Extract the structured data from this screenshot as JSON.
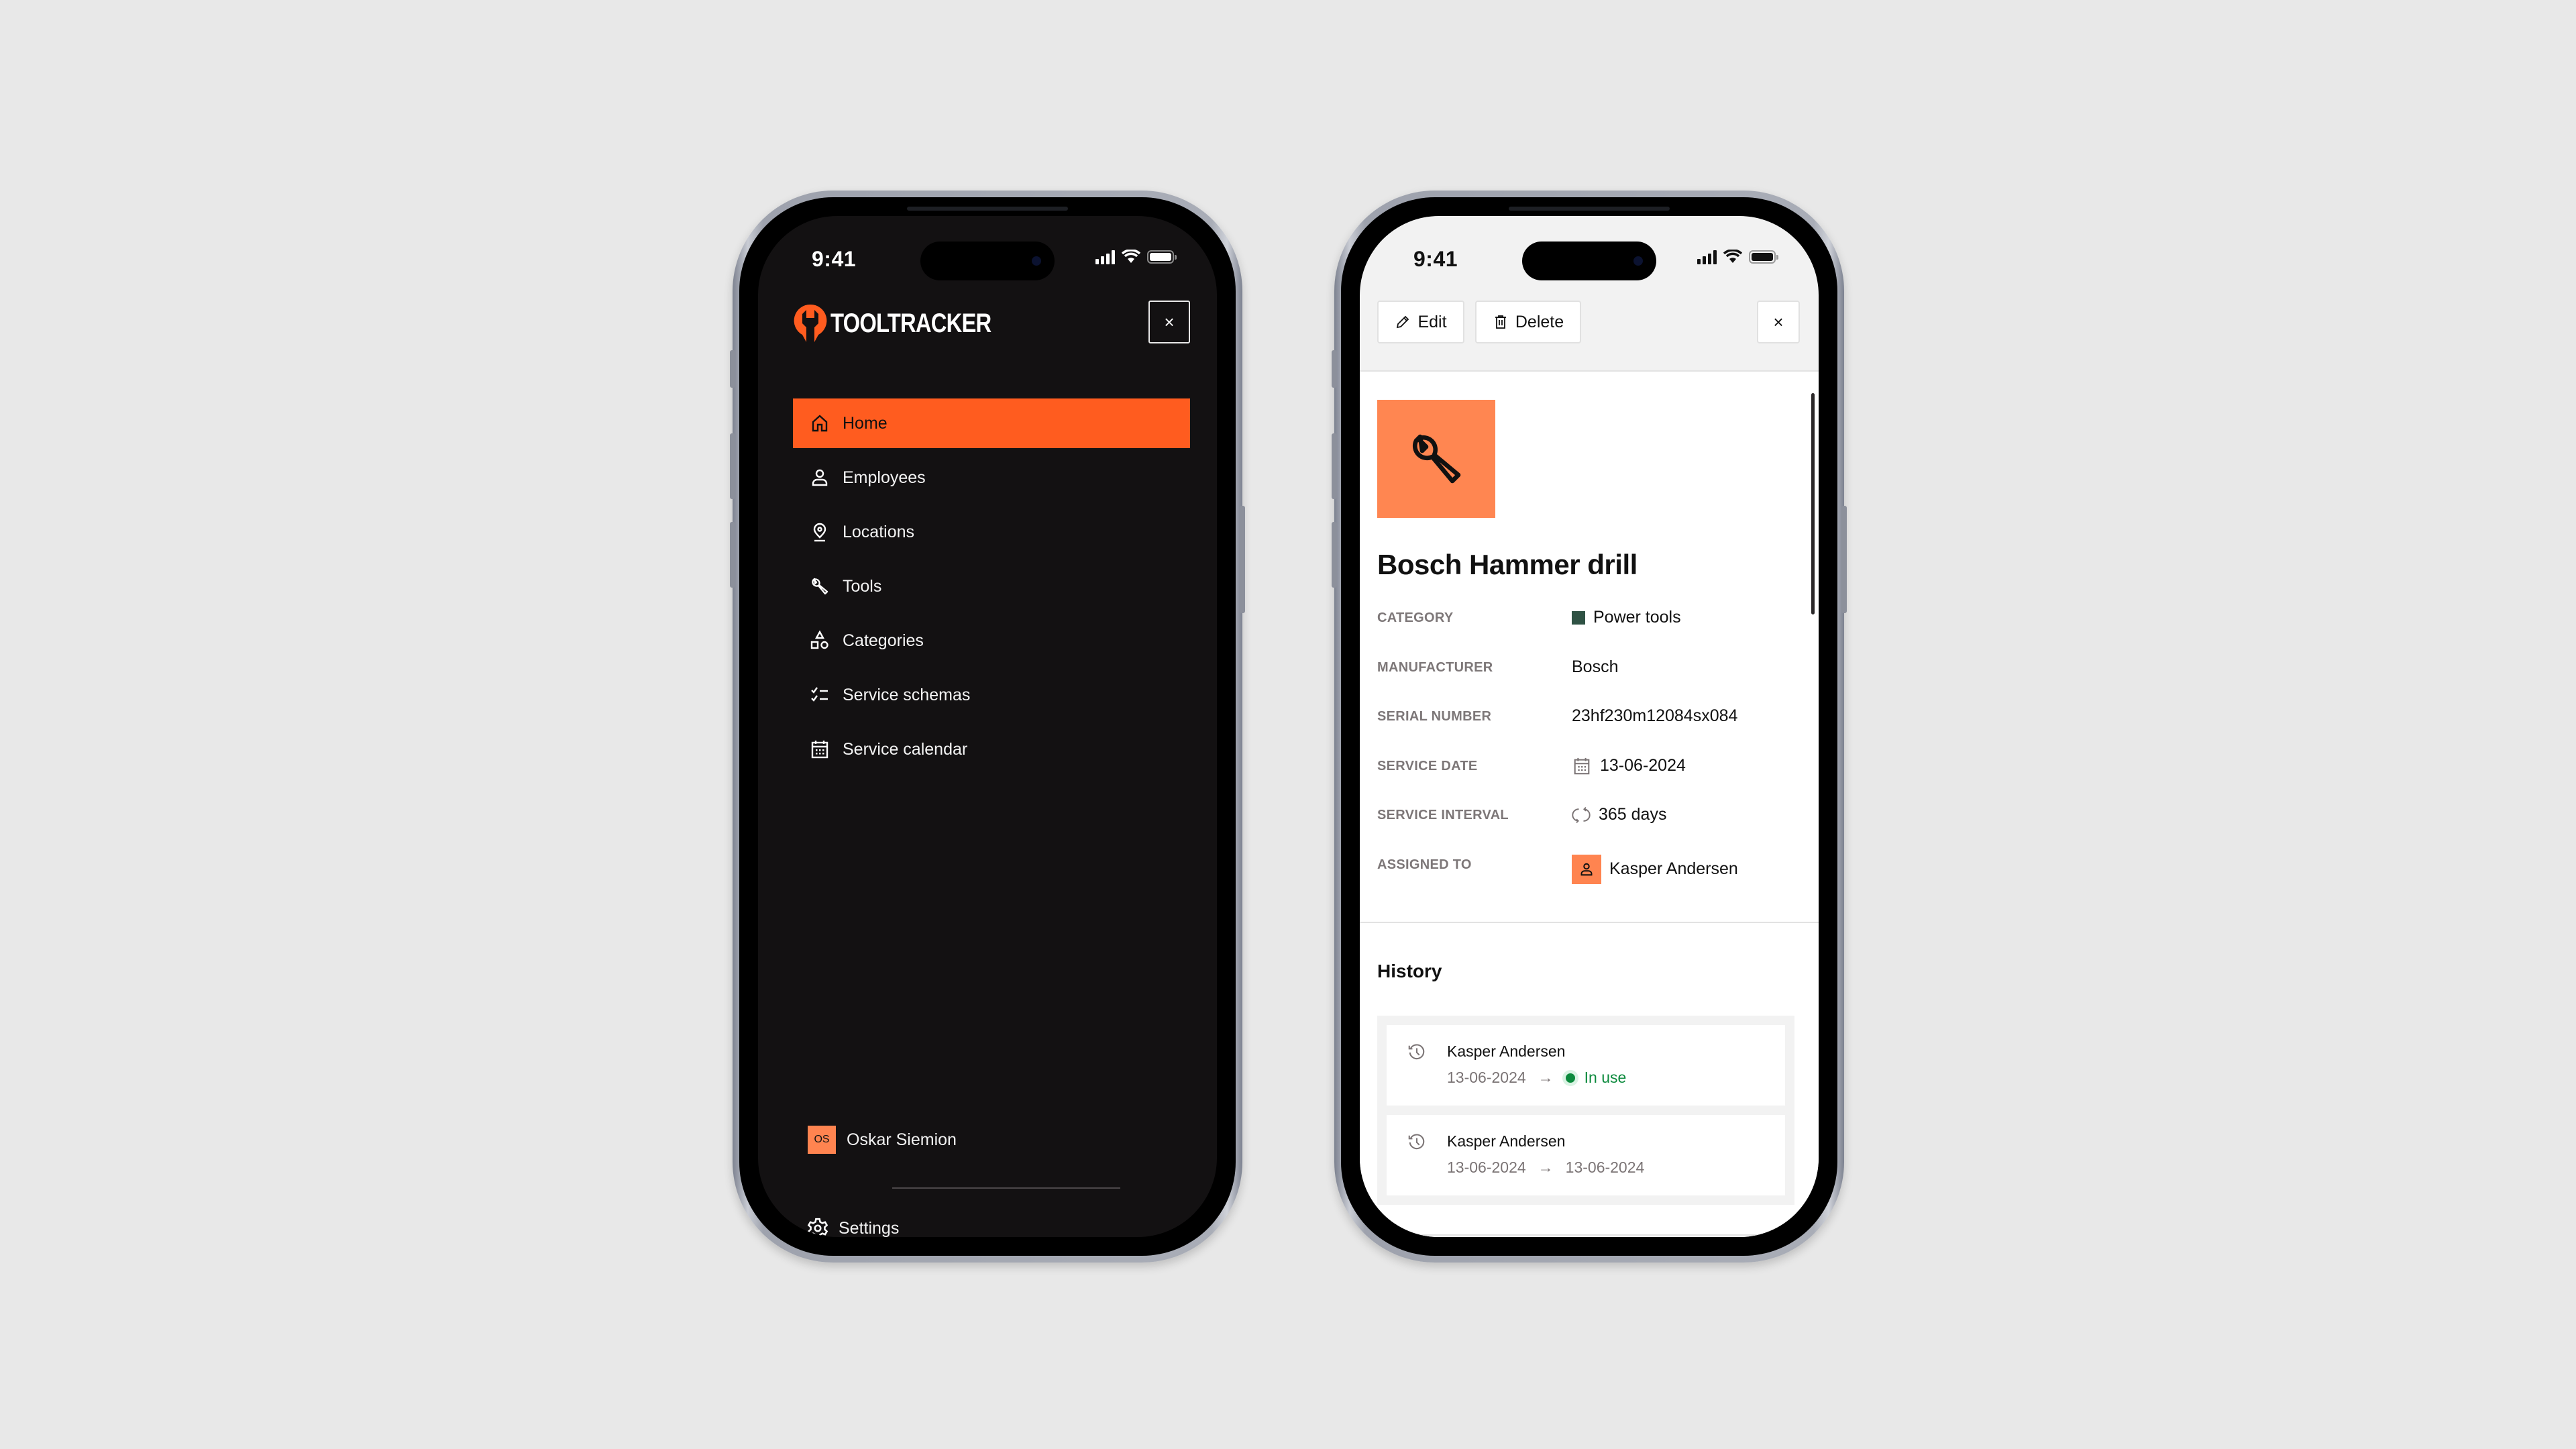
{
  "left_phone": {
    "status_bar": {
      "time": "9:41"
    },
    "brand": {
      "name": "TOOLTRACKER",
      "accent": "#ff5c1f"
    },
    "close_label": "×",
    "nav": [
      {
        "label": "Home",
        "icon": "home-icon",
        "active": true
      },
      {
        "label": "Employees",
        "icon": "user-icon",
        "active": false
      },
      {
        "label": "Locations",
        "icon": "map-pin-icon",
        "active": false
      },
      {
        "label": "Tools",
        "icon": "wrench-icon",
        "active": false
      },
      {
        "label": "Categories",
        "icon": "shapes-icon",
        "active": false
      },
      {
        "label": "Service schemas",
        "icon": "checklist-icon",
        "active": false
      },
      {
        "label": "Service calendar",
        "icon": "calendar-icon",
        "active": false
      }
    ],
    "user": {
      "initials": "OS",
      "name": "Oskar Siemion"
    },
    "settings_label": "Settings"
  },
  "right_phone": {
    "status_bar": {
      "time": "9:41"
    },
    "toolbar": {
      "edit_label": "Edit",
      "delete_label": "Delete",
      "close_label": "×"
    },
    "tool": {
      "name": "Bosch Hammer drill",
      "image_icon": "wrench-icon",
      "image_color": "#ff8651"
    },
    "properties": [
      {
        "label": "CATEGORY",
        "value": "Power tools",
        "swatch_color": "#2f5244"
      },
      {
        "label": "MANUFACTURER",
        "value": "Bosch"
      },
      {
        "label": "SERIAL NUMBER",
        "value": "23hf230m12084sx084"
      },
      {
        "label": "SERVICE DATE",
        "value": "13-06-2024",
        "icon": "calendar-icon"
      },
      {
        "label": "SERVICE INTERVAL",
        "value": "365 days",
        "icon": "refresh-icon"
      },
      {
        "label": "ASSIGNED TO",
        "value": "Kasper Andersen",
        "icon": "user-icon"
      }
    ],
    "history": {
      "title": "History",
      "items": [
        {
          "name": "Kasper Andersen",
          "from": "13-06-2024",
          "arrow": "→",
          "to": "In use",
          "status": "in-use",
          "status_color": "#0c8a3d"
        },
        {
          "name": "Kasper Andersen",
          "from": "13-06-2024",
          "arrow": "→",
          "to": "13-06-2024"
        }
      ]
    }
  }
}
